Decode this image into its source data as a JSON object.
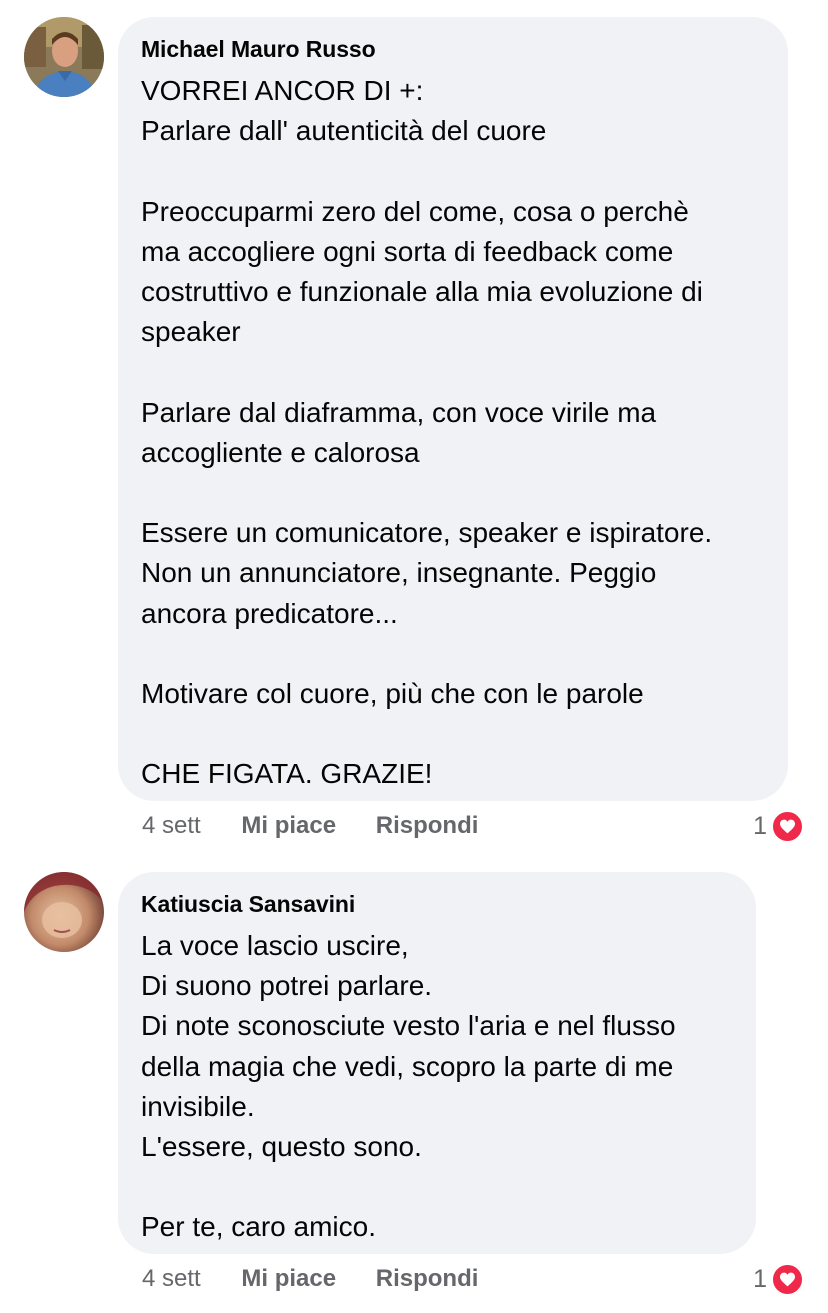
{
  "comments": [
    {
      "author": "Michael Mauro Russo",
      "lines": [
        "VORREI ANCOR DI +:",
        "Parlare dall' autenticità del cuore",
        "",
        "Preoccuparmi zero del come, cosa o perchè",
        "ma accogliere ogni sorta di feedback come",
        "costruttivo e funzionale alla mia evoluzione di",
        "speaker",
        "",
        "Parlare dal diaframma, con voce virile ma",
        "accogliente e calorosa",
        "",
        "Essere un comunicatore, speaker e ispiratore.",
        "Non un annunciatore, insegnante. Peggio",
        "ancora predicatore...",
        "",
        "Motivare col cuore, più che con le parole",
        "",
        "CHE FIGATA. GRAZIE!"
      ],
      "time": "4 sett",
      "like_label": "Mi piace",
      "reply_label": "Rispondi",
      "reaction_count": "1",
      "reaction_icon": "heart-icon"
    },
    {
      "author": "Katiuscia Sansavini",
      "lines": [
        "La voce lascio uscire,",
        "Di suono potrei parlare.",
        "Di note sconosciute vesto l'aria e nel flusso",
        "della magia che vedi, scopro la parte di me",
        "invisibile.",
        "L'essere, questo sono.",
        "",
        "Per te, caro amico."
      ],
      "time": "4 sett",
      "like_label": "Mi piace",
      "reply_label": "Rispondi",
      "reaction_count": "1",
      "reaction_icon": "heart-icon"
    }
  ],
  "colors": {
    "bubble": "#f0f2f5",
    "meta_text": "#65676b",
    "heart": "#f02849"
  }
}
